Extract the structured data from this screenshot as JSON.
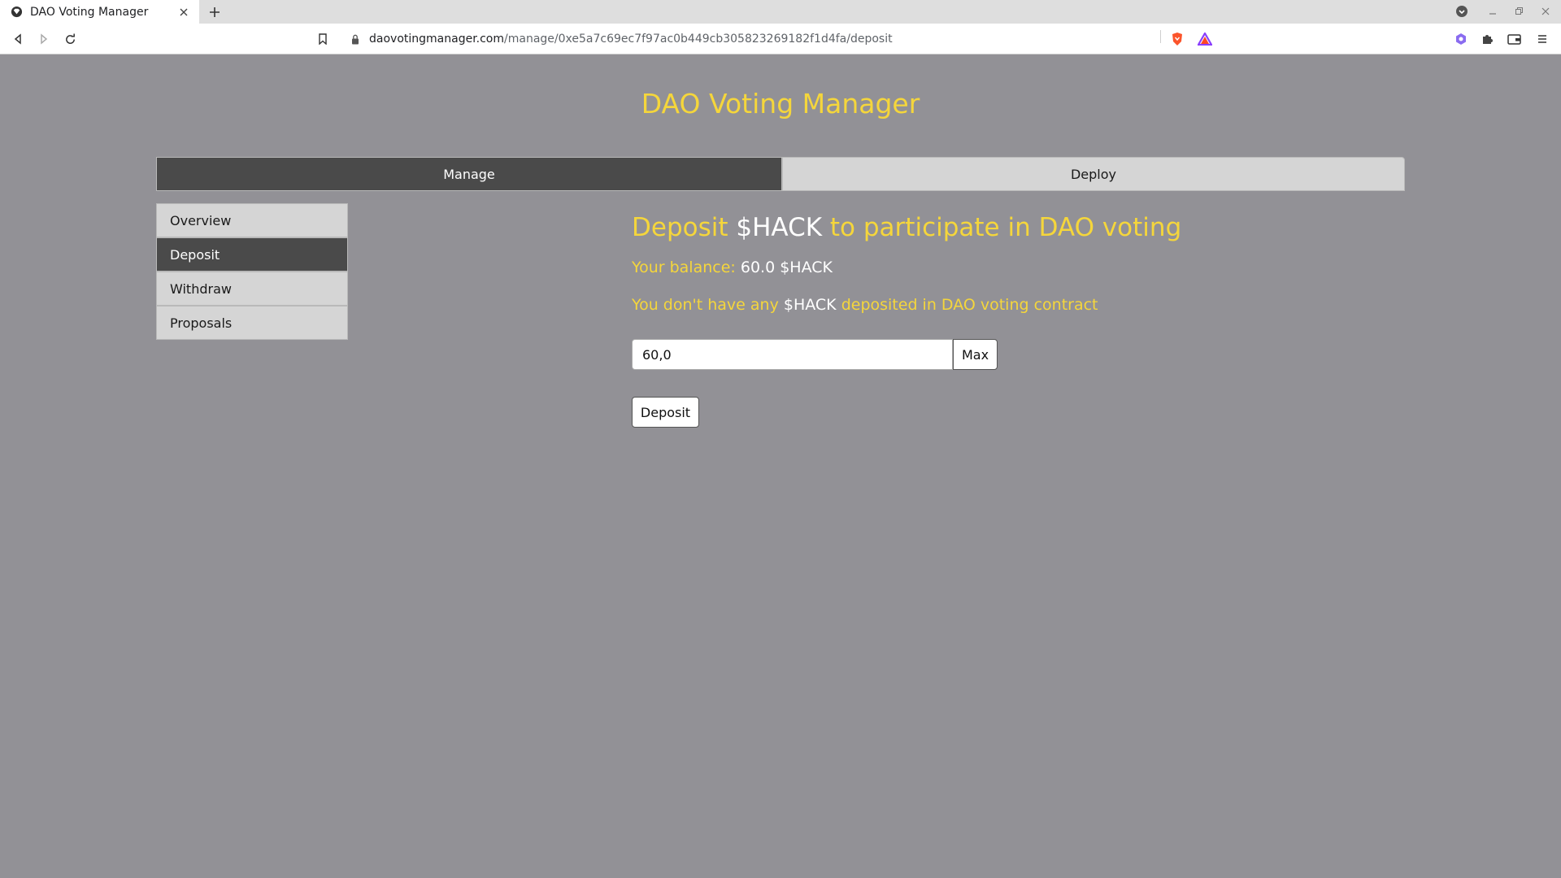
{
  "browser": {
    "tab_title": "DAO Voting Manager",
    "url_host": "daovotingmanager.com",
    "url_path": "/manage/0xe5a7c69ec7f97ac0b449cb305823269182f1d4fa/deposit"
  },
  "app": {
    "title": "DAO Voting Manager"
  },
  "top_tabs": {
    "manage": "Manage",
    "deploy": "Deploy"
  },
  "side_nav": {
    "overview": "Overview",
    "deposit": "Deposit",
    "withdraw": "Withdraw",
    "proposals": "Proposals"
  },
  "deposit": {
    "heading_prefix": "Deposit",
    "token": "$HACK",
    "heading_suffix": "to participate in DAO voting",
    "balance_label": "Your balance:",
    "balance_value": "60.0 $HACK",
    "info_prefix": "You don't have any",
    "info_token": "$HACK",
    "info_suffix": "deposited in DAO voting contract",
    "amount_value": "60,0",
    "max_label": "Max",
    "submit_label": "Deposit"
  },
  "colors": {
    "page_bg": "#929196",
    "accent_yellow": "#f5d63b",
    "active_tab": "#4a4a4a",
    "inactive_tab": "#d5d5d5"
  }
}
